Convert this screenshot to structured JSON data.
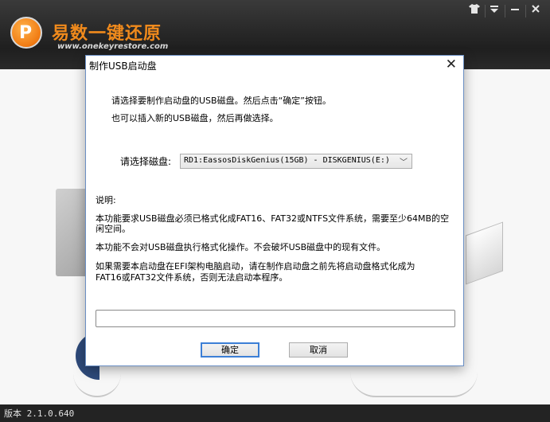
{
  "app": {
    "name": "易数一键还原",
    "url": "www.onekeyrestore.com",
    "logo_letter": "P",
    "window_controls": [
      "shirt-icon",
      "menu-icon",
      "minimize-icon",
      "close-icon"
    ],
    "version_text": "版本 2.1.0.640"
  },
  "dialog": {
    "title": "制作USB启动盘",
    "intro_line1": "请选择要制作启动盘的USB磁盘。然后点击“确定”按钮。",
    "intro_line2": "也可以插入新的USB磁盘，然后再做选择。",
    "disk_label": "请选择磁盘:",
    "disk_selected": "RD1:EassosDiskGenius(15GB) - DISKGENIUS(E:)",
    "notes_heading": "说明:",
    "note1_line1": "本功能要求USB磁盘必须已格式化成FAT16、FAT32或NTFS文件系统，需要至少64MB的空",
    "note1_line2": "闲空间。",
    "note2": "本功能不会对USB磁盘执行格式化操作。不会破坏USB磁盘中的现有文件。",
    "note3_line1": "如果需要本启动盘在EFI架构电脑启动，请在制作启动盘之前先将启动盘格式化成为",
    "note3_line2": "FAT16或FAT32文件系统，否则无法启动本程序。",
    "progress": 0,
    "ok_label": "确定",
    "cancel_label": "取消"
  }
}
